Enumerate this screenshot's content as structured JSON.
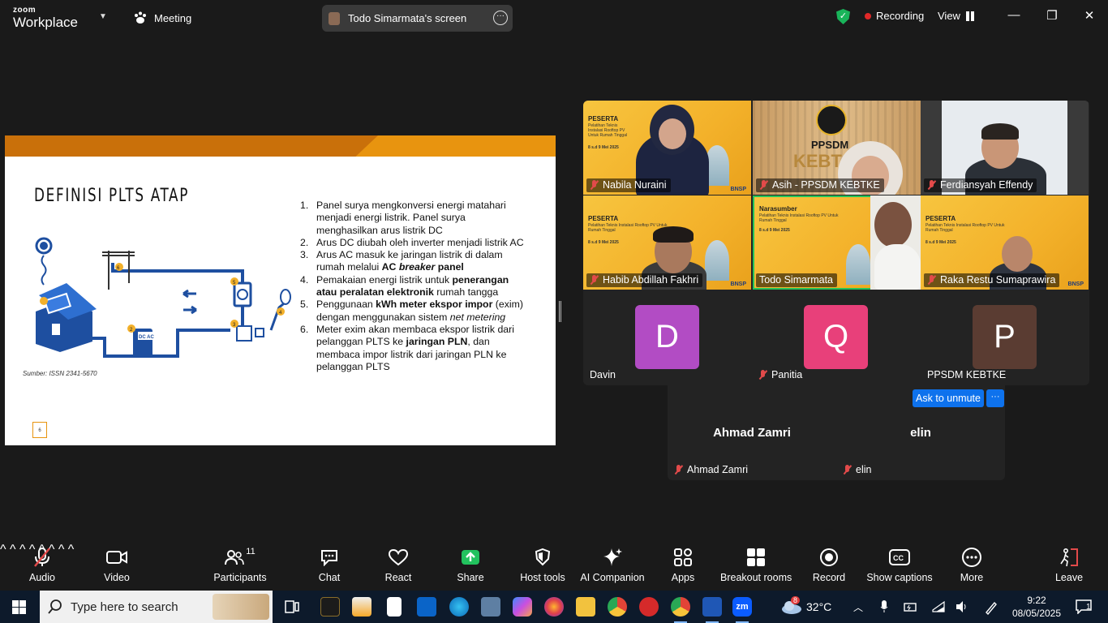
{
  "window": {
    "brand_top": "zoom",
    "brand_bottom": "Workplace",
    "meeting_label": "Meeting",
    "screen_share_label": "Todo Simarmata's screen",
    "recording_label": "Recording",
    "view_label": "View",
    "minimize": "—",
    "restore": "❐",
    "close": "✕"
  },
  "slide": {
    "title": "DEFINISI PLTS ATAP",
    "source": "Sumber: ISSN 2341-5670",
    "page_number": "6",
    "points": [
      {
        "num": "1.",
        "html": "Panel surya mengkonversi energi matahari menjadi energi listrik. Panel surya menghasilkan arus listrik DC"
      },
      {
        "num": "2.",
        "html": "Arus DC diubah oleh inverter menjadi listrik AC"
      },
      {
        "num": "3.",
        "html": "Arus AC masuk ke jaringan listrik di dalam rumah melalui <b>AC <i>breaker</i> panel</b>"
      },
      {
        "num": "4.",
        "html": "Pemakaian energi listrik untuk <b>penerangan atau peralatan elektronik</b> rumah tangga"
      },
      {
        "num": "5.",
        "html": "Penggunaan <b>kWh meter ekspor impor</b> (exim) dengan menggunakan sistem <i>net metering</i>"
      },
      {
        "num": "6.",
        "html": "Meter exim akan membaca ekspor listrik dari pelanggan PLTS ke <b>jaringan PLN</b>, dan membaca impor listrik dari jaringan PLN ke pelanggan PLTS"
      }
    ]
  },
  "gallery": {
    "participants": [
      {
        "name": "Nabila Nuraini",
        "muted": true
      },
      {
        "name": "Asih - PPSDM KEBTKE",
        "muted": true
      },
      {
        "name": "Ferdiansyah Effendy",
        "muted": true
      },
      {
        "name": "Habib Abdillah Fakhri",
        "muted": true
      },
      {
        "name": "Todo Simarmata",
        "muted": false
      },
      {
        "name": "Raka Restu Sumaprawira",
        "muted": true
      },
      {
        "name": "Davin",
        "muted": false,
        "initial": "D",
        "color": "#b24cc4"
      },
      {
        "name": "Panitia",
        "muted": true,
        "initial": "Q",
        "color": "#e8407a"
      },
      {
        "name": "PPSDM KEBTKE",
        "muted": false,
        "initial": "P",
        "color": "#5a3c32"
      },
      {
        "name": "Ahmad Zamri",
        "muted": true
      },
      {
        "name": "elin",
        "muted": true
      }
    ],
    "peserta_label": "PESERTA",
    "narasumber_label": "Narasumber",
    "banner_text": "Pelatihan Teknis Instalasi Rooftop PV Untuk Rumah Tinggal",
    "banner_date": "8 s.d 9 Mei 2025",
    "banner_org": "PPSDM",
    "banner_org2": "KEBT",
    "bnsp": "BNSP",
    "ask_unmute": "Ask to unmute",
    "more": "···"
  },
  "toolbar": {
    "audio": "Audio",
    "video": "Video",
    "participants": "Participants",
    "participant_count": "11",
    "chat": "Chat",
    "react": "React",
    "share": "Share",
    "host_tools": "Host tools",
    "ai_companion": "AI Companion",
    "apps": "Apps",
    "breakout": "Breakout rooms",
    "record": "Record",
    "captions": "Show captions",
    "more": "More",
    "leave": "Leave"
  },
  "taskbar": {
    "search_placeholder": "Type here to search",
    "temperature": "32°C",
    "weather_badge": "8",
    "time": "9:22",
    "date": "08/05/2025",
    "notifications": "1",
    "zoom_icon": "zm"
  },
  "colors": {
    "accent_blue": "#0e72ed",
    "active_speaker": "#25c35a",
    "recording_red": "#e02828",
    "slide_orange": "#e8940f"
  }
}
